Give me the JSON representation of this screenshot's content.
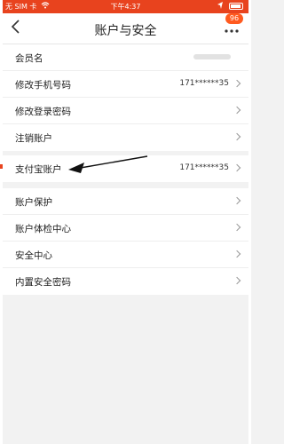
{
  "status_bar": {
    "carrier": "无 SIM 卡",
    "time": "下午4:37"
  },
  "header": {
    "back_icon": "chevron-left",
    "title": "账户与安全",
    "more_icon": "ellipsis",
    "badge": "96"
  },
  "group1": {
    "items": [
      {
        "label": "会员名",
        "value": ""
      },
      {
        "label": "修改手机号码",
        "value": "171******35"
      },
      {
        "label": "修改登录密码",
        "value": ""
      },
      {
        "label": "注销账户",
        "value": ""
      }
    ]
  },
  "group2": {
    "items": [
      {
        "label": "支付宝账户",
        "value": "171******35"
      }
    ]
  },
  "group3": {
    "items": [
      {
        "label": "账户保护"
      },
      {
        "label": "账户体检中心"
      },
      {
        "label": "安全中心"
      },
      {
        "label": "内置安全密码"
      }
    ]
  },
  "colors": {
    "accent": "#e8431e",
    "background": "#f2f2f2"
  }
}
